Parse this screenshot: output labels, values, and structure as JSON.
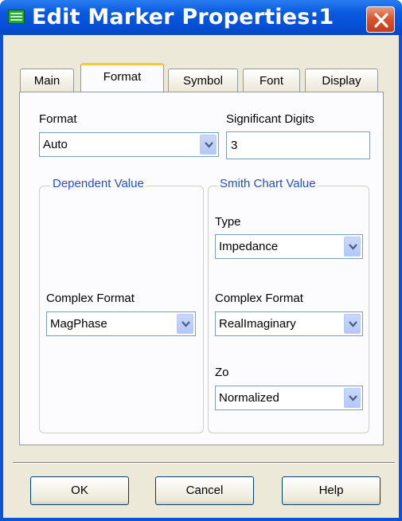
{
  "window": {
    "title": "Edit Marker Properties:1"
  },
  "tabs": [
    {
      "label": "Main",
      "active": false
    },
    {
      "label": "Format",
      "active": true
    },
    {
      "label": "Symbol",
      "active": false
    },
    {
      "label": "Font",
      "active": false
    },
    {
      "label": "Display",
      "active": false
    }
  ],
  "format": {
    "label": "Format",
    "selected": "Auto"
  },
  "significant_digits": {
    "label": "Significant Digits",
    "value": "3"
  },
  "dependent_value": {
    "group_label": "Dependent Value",
    "complex_format_label": "Complex Format",
    "complex_format_selected": "MagPhase"
  },
  "smith_chart_value": {
    "group_label": "Smith Chart Value",
    "type_label": "Type",
    "type_selected": "Impedance",
    "complex_format_label": "Complex Format",
    "complex_format_selected": "RealImaginary",
    "zo_label": "Zo",
    "zo_selected": "Normalized"
  },
  "buttons": {
    "ok": "OK",
    "cancel": "Cancel",
    "help": "Help"
  },
  "colors": {
    "titlebar": "#0b5be0",
    "group_label": "#2150cf",
    "active_tab_highlight": "#ffc83c",
    "close_button": "#d9572d"
  },
  "icons": {
    "window": "app-icon",
    "close": "close-icon",
    "dropdown": "chevron-down-icon"
  }
}
